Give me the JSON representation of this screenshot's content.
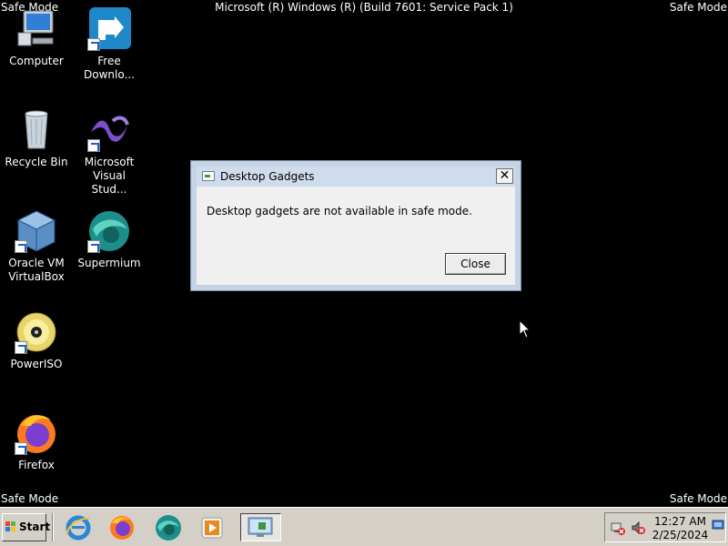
{
  "screen": {
    "safe_mode_label": "Safe Mode",
    "title": "Microsoft (R) Windows (R) (Build 7601: Service Pack 1)"
  },
  "desktop_icons": [
    {
      "label_line1": "Computer",
      "label_line2": ""
    },
    {
      "label_line1": "Free",
      "label_line2": "Downlo..."
    },
    {
      "label_line1": "Recycle Bin",
      "label_line2": ""
    },
    {
      "label_line1": "Microsoft",
      "label_line2": "Visual Stud..."
    },
    {
      "label_line1": "Oracle VM",
      "label_line2": "VirtualBox"
    },
    {
      "label_line1": "Supermium",
      "label_line2": ""
    },
    {
      "label_line1": "PowerISO",
      "label_line2": ""
    },
    {
      "label_line1": "Firefox",
      "label_line2": ""
    }
  ],
  "dialog": {
    "title": "Desktop Gadgets",
    "message": "Desktop gadgets are not available in safe mode.",
    "close_button": "Close",
    "close_x": "✕"
  },
  "taskbar": {
    "start_label": "Start",
    "pinned": [
      "ie-icon",
      "firefox-icon",
      "supermium-icon",
      "media-player-icon",
      "gadgets-icon"
    ],
    "clock_time": "12:27 AM",
    "clock_date": "2/25/2024"
  },
  "colors": {
    "desktop": "#000000",
    "dialog_frame": "#c4d3e6",
    "taskbar": "#d4d0c8"
  }
}
